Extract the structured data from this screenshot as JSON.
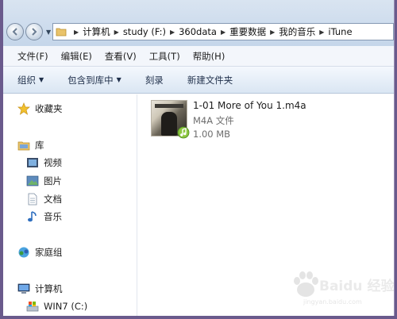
{
  "address": {
    "crumbs": [
      "计算机",
      "study (F:)",
      "360data",
      "重要数据",
      "我的音乐",
      "iTune"
    ]
  },
  "menu": [
    "文件(F)",
    "编辑(E)",
    "查看(V)",
    "工具(T)",
    "帮助(H)"
  ],
  "toolbar": {
    "organize": "组织",
    "include_library": "包含到库中",
    "burn": "刻录",
    "new_folder": "新建文件夹"
  },
  "nav": {
    "favorites": "收藏夹",
    "libraries": "库",
    "videos": "视频",
    "pictures": "图片",
    "documents": "文档",
    "music": "音乐",
    "homegroup": "家庭组",
    "computer": "计算机",
    "drive_c": "WIN7 (C:)"
  },
  "file": {
    "name": "1-01 More of You 1.m4a",
    "type": "M4A 文件",
    "size": "1.00 MB"
  },
  "watermark": {
    "logo_text": "Baidu 经验",
    "sub": "jingyan.baidu.com"
  }
}
